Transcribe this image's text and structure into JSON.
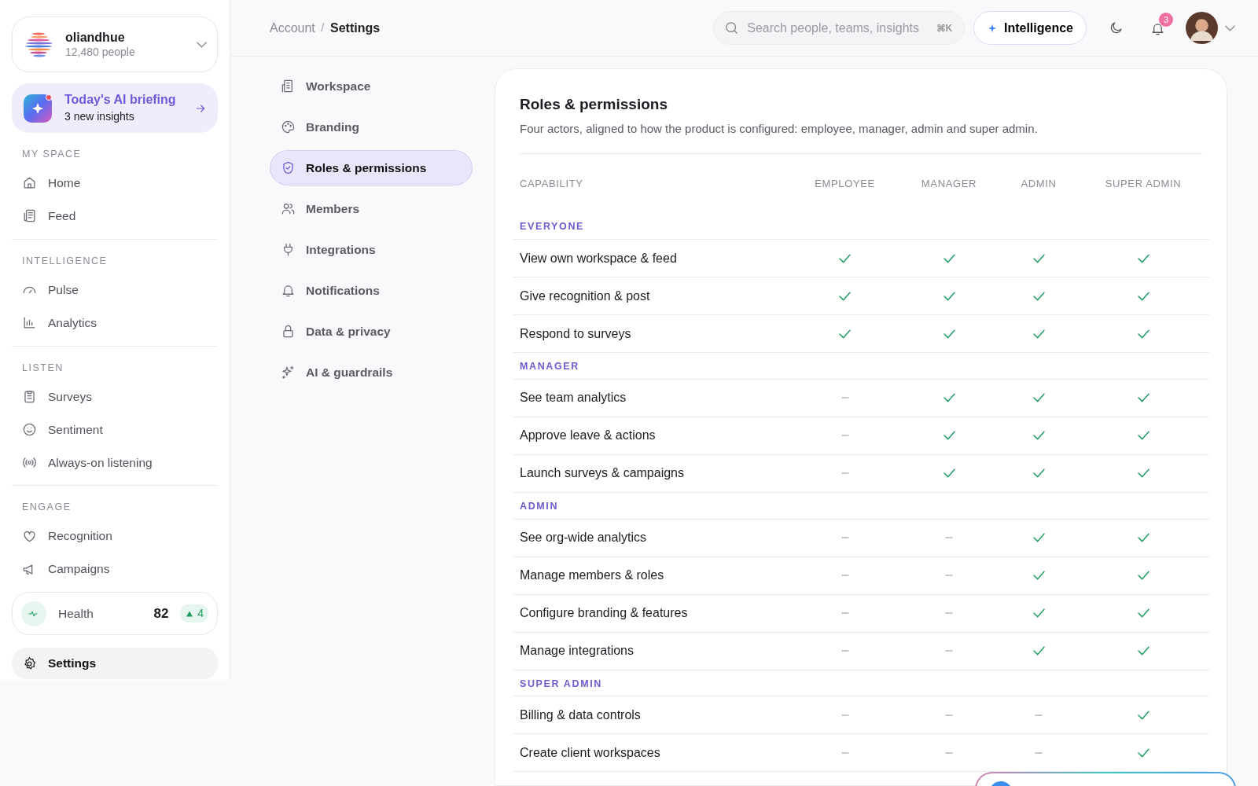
{
  "org": {
    "name": "oliandhue",
    "people": "12,480 people"
  },
  "briefing": {
    "title": "Today's AI briefing",
    "subtitle": "3 new insights",
    "unread": true
  },
  "sidebar": {
    "sections": [
      {
        "label": "MY SPACE",
        "items": [
          {
            "label": "Home",
            "selected": false
          },
          {
            "label": "Feed",
            "selected": false
          }
        ]
      },
      {
        "label": "INTELLIGENCE",
        "items": [
          {
            "label": "Pulse",
            "selected": false
          },
          {
            "label": "Analytics",
            "selected": false
          }
        ]
      },
      {
        "label": "LISTEN",
        "items": [
          {
            "label": "Surveys",
            "selected": false
          },
          {
            "label": "Sentiment",
            "selected": false
          },
          {
            "label": "Always-on listening",
            "selected": false
          }
        ]
      },
      {
        "label": "ENGAGE",
        "items": [
          {
            "label": "Recognition",
            "selected": false
          },
          {
            "label": "Campaigns",
            "selected": false
          }
        ]
      }
    ],
    "health": {
      "label": "Health",
      "score": "82",
      "delta": "4"
    },
    "settings": {
      "label": "Settings",
      "selected": true
    }
  },
  "breadcrumb": [
    "Account",
    "Settings"
  ],
  "breadcrumb_separator": "/",
  "search": {
    "placeholder": "Search people, teams, insights",
    "shortcut": "⌘K"
  },
  "intelligence_button": "Intelligence",
  "notifications": {
    "count": "3"
  },
  "settings_nav": [
    {
      "label": "Workspace",
      "selected": false
    },
    {
      "label": "Branding",
      "selected": false
    },
    {
      "label": "Roles & permissions",
      "selected": true
    },
    {
      "label": "Members",
      "selected": false
    },
    {
      "label": "Integrations",
      "selected": false
    },
    {
      "label": "Notifications",
      "selected": false
    },
    {
      "label": "Data & privacy",
      "selected": false
    },
    {
      "label": "AI & guardrails",
      "selected": false
    }
  ],
  "panel": {
    "title": "Roles & permissions",
    "description": "Four actors, aligned to how the product is configured: employee, manager, admin and super admin.",
    "table": {
      "columns": [
        "CAPABILITY",
        "EMPLOYEE",
        "MANAGER",
        "ADMIN",
        "SUPER ADMIN"
      ],
      "groups": [
        {
          "label": "EVERYONE",
          "rows": [
            {
              "capability": "View own workspace & feed",
              "access": [
                true,
                true,
                true,
                true
              ]
            },
            {
              "capability": "Give recognition & post",
              "access": [
                true,
                true,
                true,
                true
              ]
            },
            {
              "capability": "Respond to surveys",
              "access": [
                true,
                true,
                true,
                true
              ]
            }
          ]
        },
        {
          "label": "MANAGER",
          "rows": [
            {
              "capability": "See team analytics",
              "access": [
                false,
                true,
                true,
                true
              ]
            },
            {
              "capability": "Approve leave & actions",
              "access": [
                false,
                true,
                true,
                true
              ]
            },
            {
              "capability": "Launch surveys & campaigns",
              "access": [
                false,
                true,
                true,
                true
              ]
            }
          ]
        },
        {
          "label": "ADMIN",
          "rows": [
            {
              "capability": "See org-wide analytics",
              "access": [
                false,
                false,
                true,
                true
              ]
            },
            {
              "capability": "Manage members & roles",
              "access": [
                false,
                false,
                true,
                true
              ]
            },
            {
              "capability": "Configure branding & features",
              "access": [
                false,
                false,
                true,
                true
              ]
            },
            {
              "capability": "Manage integrations",
              "access": [
                false,
                false,
                true,
                true
              ]
            }
          ]
        },
        {
          "label": "SUPER ADMIN",
          "rows": [
            {
              "capability": "Billing & data controls",
              "access": [
                false,
                false,
                false,
                true
              ]
            },
            {
              "capability": "Create client workspaces",
              "access": [
                false,
                false,
                false,
                true
              ]
            }
          ]
        }
      ]
    }
  }
}
